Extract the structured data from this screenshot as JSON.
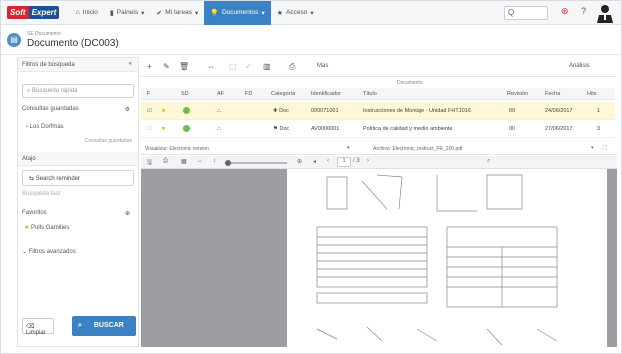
{
  "brand": {
    "soft": "Soft",
    "expert": "Expert"
  },
  "nav": [
    {
      "label": "Inicio",
      "icon": "home-icon",
      "glyph": "⌂"
    },
    {
      "label": "Paineis",
      "icon": "dashboard-icon",
      "glyph": "▮"
    },
    {
      "label": "Mi tareas",
      "icon": "check-icon",
      "glyph": "✔"
    },
    {
      "label": "Documentos",
      "icon": "bulb-icon",
      "glyph": "💡"
    },
    {
      "label": "Acceso",
      "icon": "star-icon",
      "glyph": "★"
    }
  ],
  "search": {
    "value": "Q"
  },
  "header": {
    "subtitle": "SE Documento",
    "title": "Documento (DC003)"
  },
  "left": {
    "filter_title": "Filtros de búsqueda",
    "search_placeholder": "Búsqueda rápida",
    "saved_title": "Consultas guardadas",
    "saved_item": "Los Dorfmas",
    "saved_link": "Consultas guardadas",
    "shortcut_title": "Atajo",
    "shortcut_button": "Search reminder",
    "shortcut_hint": "Búsqueda fast",
    "favorites_title": "Favoritos",
    "favorites_item": "Pulls Gamities",
    "advanced_title": "Filtros avanzados",
    "clear_label": "Limpiar",
    "search_label": "BUSCAR"
  },
  "toolbar": {
    "more_label": "Mas",
    "analysis_label": "Análisis"
  },
  "grid": {
    "group_label": "Documento",
    "headers": [
      "",
      "F",
      "SD",
      "AF",
      "FD",
      "Categoría",
      "Identificador",
      "Título",
      "Revisión",
      "Fecha",
      "Hits"
    ],
    "rows": [
      {
        "category": "Doc",
        "id": "000071001",
        "title": "Instrucciones de Montaje - Unidad FHT1016",
        "rev": "00",
        "date": "24/06/2017",
        "hits": "1"
      },
      {
        "category": "Doc",
        "id": "AV0000001",
        "title": "Política de calidad y medio ambiente",
        "rev": "00",
        "date": "27/06/2017",
        "hits": "3"
      }
    ]
  },
  "viewer": {
    "view_label": "Visualizar: Electronic version",
    "file_label": "Archivo: Electronic_Instruct_FR_200.pdf",
    "page": "1",
    "total": "/ 3"
  },
  "colors": {
    "accent": "#3b82c4",
    "selected_row": "#fff7d6"
  }
}
